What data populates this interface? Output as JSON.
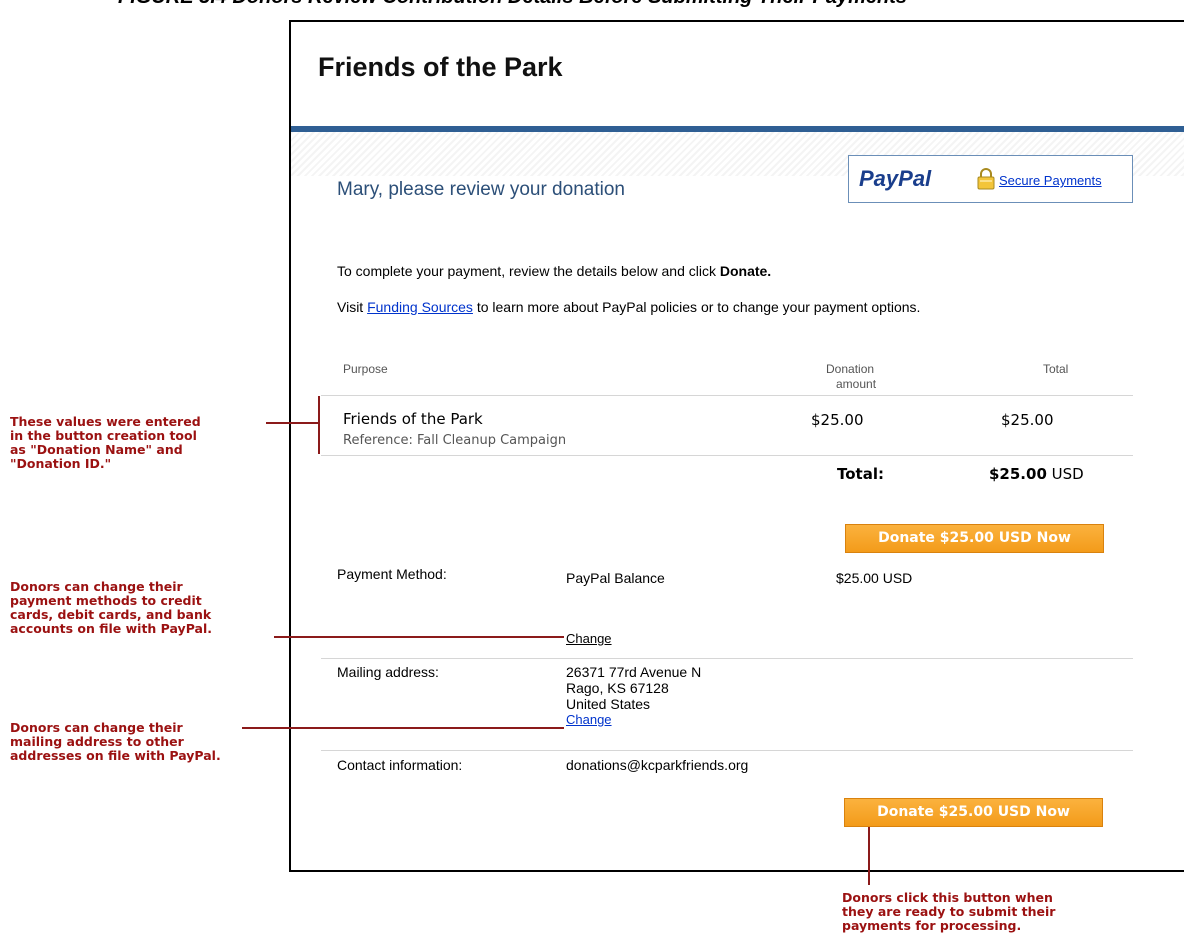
{
  "figure_caption": "FIGURE 3.4 Donors Review Contribution Details Before Submitting Their Payments",
  "header": {
    "title": "Friends of the Park"
  },
  "paypal": {
    "logo": "PayPal",
    "secure_link": "Secure Payments"
  },
  "review_heading": "Mary, please review your donation",
  "instructions": {
    "line1_prefix": "To complete your payment, review the details below and click ",
    "line1_bold": "Donate.",
    "line2_prefix": "Visit ",
    "line2_link": "Funding Sources",
    "line2_suffix": " to learn more about PayPal policies or to change your payment options."
  },
  "table": {
    "headers": {
      "purpose": "Purpose",
      "donation_amount_1": "Donation",
      "donation_amount_2": "amount",
      "total": "Total"
    },
    "row": {
      "name": "Friends of the Park",
      "reference": "Reference: Fall Cleanup Campaign",
      "amount": "$25.00",
      "total": "$25.00"
    },
    "total_label": "Total:",
    "total_value": "$25.00",
    "total_currency": "USD"
  },
  "donate_button_label": "Donate $25.00 USD Now",
  "payment": {
    "label": "Payment Method:",
    "method": "PayPal Balance",
    "amount": "$25.00 USD",
    "change": "Change"
  },
  "mailing": {
    "label": "Mailing address:",
    "line1": "26371 77rd Avenue N",
    "line2": "Rago, KS 67128",
    "line3": "United States",
    "change": "Change"
  },
  "contact": {
    "label": "Contact information:",
    "email": "donations@kcparkfriends.org"
  },
  "annotations": {
    "values": [
      "These values were entered",
      "in the button creation tool",
      "as \"Donation Name\" and",
      "\"Donation ID.\""
    ],
    "payment": [
      "Donors can change their",
      "payment methods to credit",
      "cards, debit cards, and bank",
      "accounts on file with PayPal."
    ],
    "address": [
      "Donors can change their",
      "mailing address to other",
      "addresses on file with PayPal."
    ],
    "button": [
      "Donors click this button when",
      "they are ready to submit their",
      "payments for processing."
    ]
  },
  "colors": {
    "accent_bar": "#2f5f94",
    "heading": "#2c4f78",
    "button": "#f5a623",
    "annotation": "#9b1111",
    "link": "#0033cc"
  }
}
